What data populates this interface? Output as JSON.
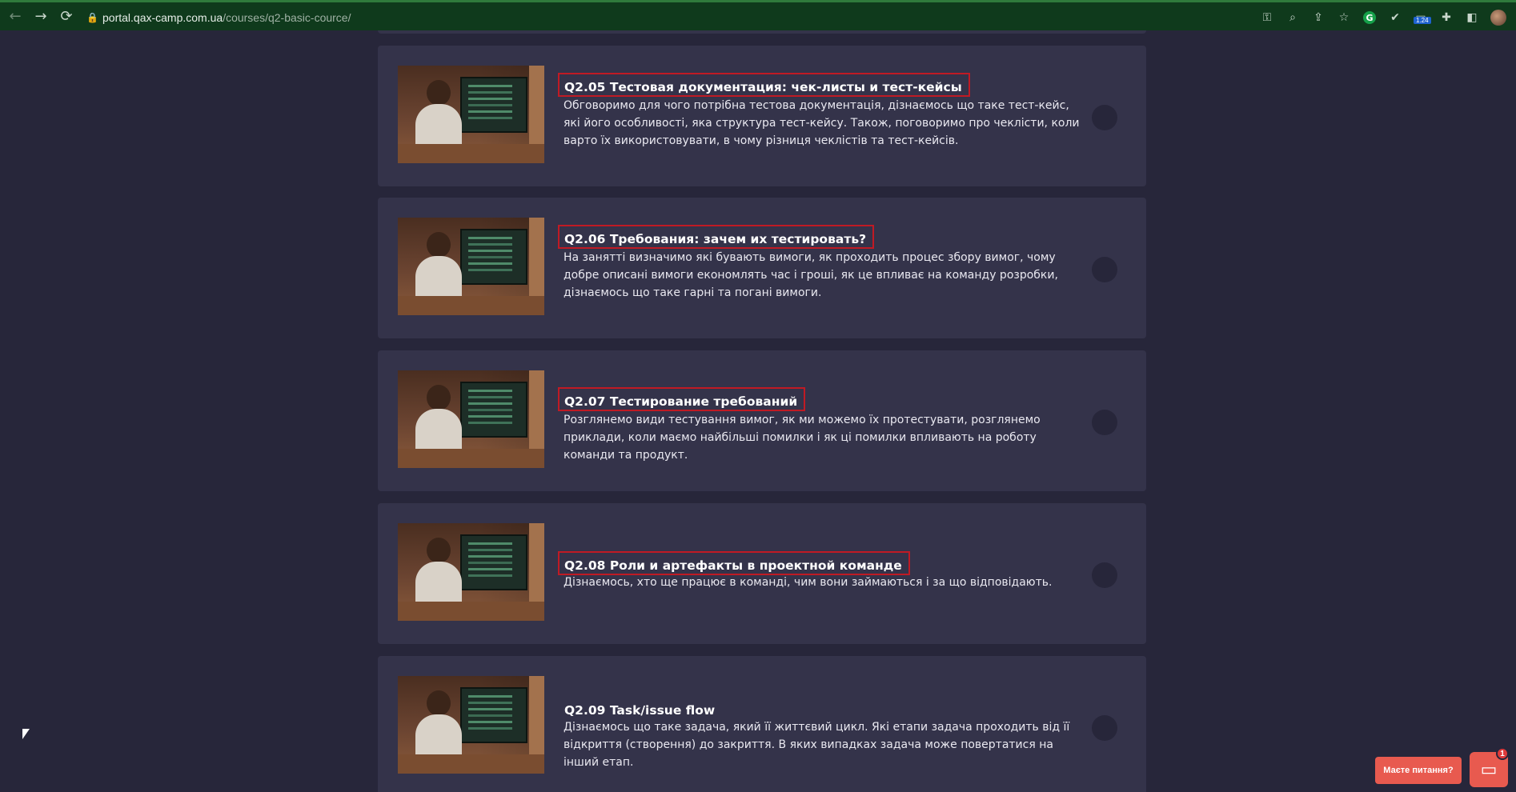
{
  "browser": {
    "url_domain": "portal.qax-camp.com.ua",
    "url_path": "/courses/q2-basic-cource/",
    "back_icon": "←",
    "forward_icon": "→",
    "reload_icon": "⟳",
    "extension_badge": "1.24"
  },
  "lessons": [
    {
      "title": "Q2.05 Тестовая документация: чек-листы и тест-кейсы",
      "description": "Обговоримо для чого потрібна тестова документація, дізнаємось що таке тест-кейс, які його особливості, яка структура тест-кейсу. Також, поговоримо про чеклісти, коли варто їх використовувати, в чому різниця чеклістів та тест-кейсів.",
      "highlighted": true
    },
    {
      "title": "Q2.06 Требования: зачем их тестировать?",
      "description": "На занятті визначимо які бувають вимоги, як проходить процес збору вимог, чому добре описані вимоги економлять час і гроші, як це впливає на команду розробки, дізнаємось що таке гарні та погані вимоги.",
      "highlighted": true
    },
    {
      "title": "Q2.07 Тестирование требований",
      "description": "Розглянемо види тестування вимог, як ми можемо їх протестувати, розглянемо приклади, коли маємо найбільші помилки і як ці помилки впливають на роботу команди та продукт.",
      "highlighted": true
    },
    {
      "title": "Q2.08 Роли и артефакты в проектной команде",
      "description": "Дізнаємось, хто ще працює в команді, чим вони займаються і за що відповідають.",
      "highlighted": true
    },
    {
      "title": "Q2.09 Task/issue flow",
      "description": "Дізнаємось що таке задача, який її життєвий цикл. Які етапи задача проходить від її відкриття (створення) до закриття. В яких випадках задача може повертатися на інший етап.",
      "highlighted": false
    }
  ],
  "chat": {
    "prompt": "Маєте питання?",
    "badge": "1"
  }
}
